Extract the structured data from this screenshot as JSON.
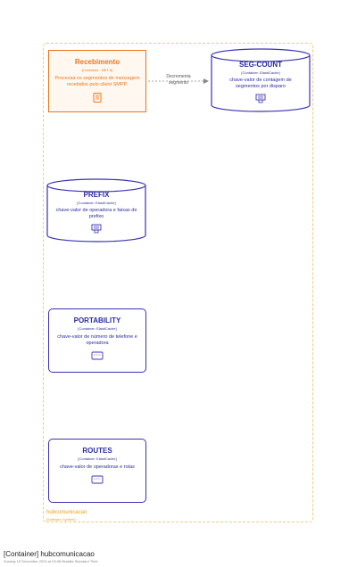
{
  "boundary": {
    "name": "hubcomunicacao",
    "type": "[Software System]"
  },
  "nodes": {
    "recebimento": {
      "title": "Recebimento",
      "tech": "[Container: .NET 6]",
      "description": "Processa os segmentos de mensagem recebidos pelo client SMPP.",
      "icon": "document-icon"
    },
    "seg_count": {
      "title": "SEG-COUNT",
      "tech": "[Container: ElastiCache]",
      "description": "chave-valor de contagem de segmentos por disparo",
      "icon": "cache-icon"
    },
    "prefix": {
      "title": "PREFIX",
      "tech": "[Container: ElastiCache]",
      "description": "chave-valor de operadora e faixas de prefixo",
      "icon": "cache-icon"
    },
    "portability": {
      "title": "PORTABILITY",
      "tech": "[Container: ElastiCache]",
      "description": "chave-valor de número de telefone e operadora",
      "icon": "cache-icon"
    },
    "routes": {
      "title": "ROUTES",
      "tech": "[Container: ElastiCache]",
      "description": "chave-valor de operadoras e rotas",
      "icon": "cache-icon"
    }
  },
  "edges": [
    {
      "from": "Recebimento",
      "to": "SEG-COUNT",
      "label": "Decrementa segmento"
    }
  ],
  "footer": {
    "title": "[Container] hubcomunicacao",
    "subtitle": "Sunday 15 December 2024 at 03:08 Brasilia Standard Time"
  },
  "colors": {
    "orange": "#e8761f",
    "blue": "#3a32b4",
    "boundary": "#f5c97a"
  }
}
